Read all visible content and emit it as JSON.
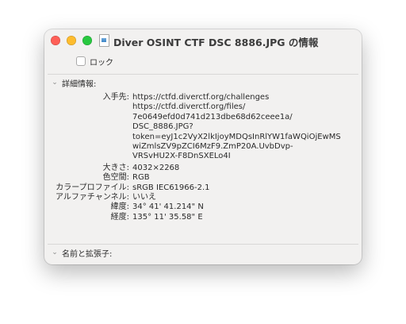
{
  "window": {
    "title": "Diver OSINT CTF DSC 8886.JPG の情報",
    "lock_label": "ロック",
    "lock_checked": false
  },
  "details": {
    "header": "詳細情報:",
    "where_from_label": "入手先:",
    "where_from_lines": [
      "https://ctfd.diverctf.org/challenges",
      "https://ctfd.diverctf.org/files/",
      "7e0649efd0d741d213dbe68d62ceee1a/",
      "DSC_8886.JPG?",
      "token=eyJ1c2VyX2lkIjoyMDQsInRlYW1faWQiOjEwMS",
      "wiZmlsZV9pZCI6MzF9.ZmP20A.UvbDvp-",
      "VRSvHU2X-F8DnSXELo4I"
    ],
    "size_label": "大きさ:",
    "size_value": "4032×2268",
    "color_space_label": "色空間:",
    "color_space_value": "RGB",
    "color_profile_label": "カラープロファイル:",
    "color_profile_value": "sRGB IEC61966-2.1",
    "alpha_label": "アルファチャンネル:",
    "alpha_value": "いいえ",
    "latitude_label": "緯度:",
    "latitude_value": "34° 41' 41.214\" N",
    "longitude_label": "経度:",
    "longitude_value": "135° 11' 35.58\" E"
  },
  "name_section": {
    "header": "名前と拡張子:"
  },
  "icons": {
    "file": "jpeg-file-icon",
    "expand": "chevron-down-icon"
  },
  "colors": {
    "close": "#ff5f57",
    "minimize": "#febc2e",
    "maximize": "#28c840",
    "window_bg": "#f2f1f0"
  }
}
